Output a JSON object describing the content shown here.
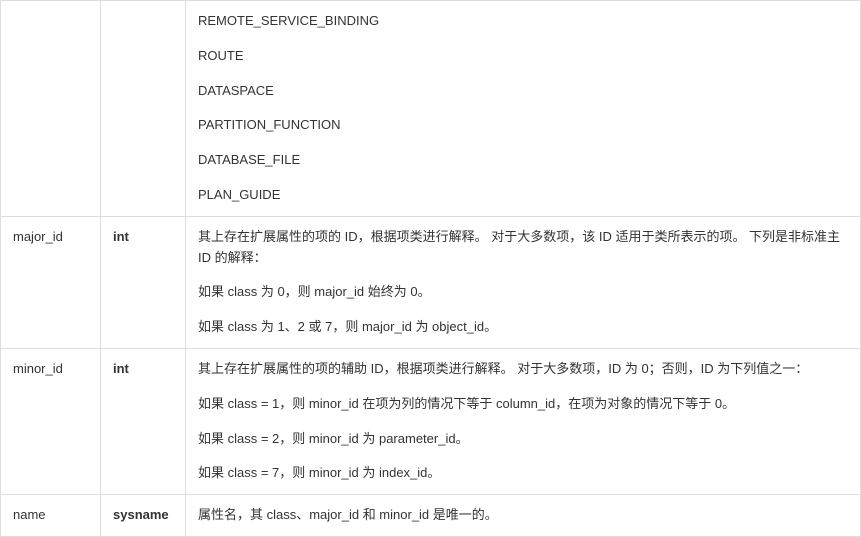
{
  "rows": [
    {
      "name": "",
      "type": "",
      "desc_lines": [
        "REMOTE_SERVICE_BINDING",
        "ROUTE",
        "DATASPACE",
        "PARTITION_FUNCTION",
        "DATABASE_FILE",
        "PLAN_GUIDE"
      ]
    },
    {
      "name": "major_id",
      "type": "int",
      "desc_lines": [
        "其上存在扩展属性的项的 ID，根据项类进行解释。 对于大多数项，该 ID 适用于类所表示的项。 下列是非标准主 ID 的解释：",
        "如果 class 为 0，则 major_id 始终为 0。",
        "如果 class 为 1、2 或 7，则 major_id 为 object_id。"
      ]
    },
    {
      "name": "minor_id",
      "type": "int",
      "desc_lines": [
        "其上存在扩展属性的项的辅助 ID，根据项类进行解释。 对于大多数项，ID 为 0；否则，ID 为下列值之一：",
        "如果 class = 1，则 minor_id 在项为列的情况下等于 column_id，在项为对象的情况下等于 0。",
        "如果 class = 2，则 minor_id 为 parameter_id。",
        "如果 class = 7，则 minor_id 为 index_id。"
      ]
    },
    {
      "name": "name",
      "type": "sysname",
      "desc_lines": [
        "属性名，其 class、major_id 和 minor_id 是唯一的。"
      ]
    }
  ]
}
